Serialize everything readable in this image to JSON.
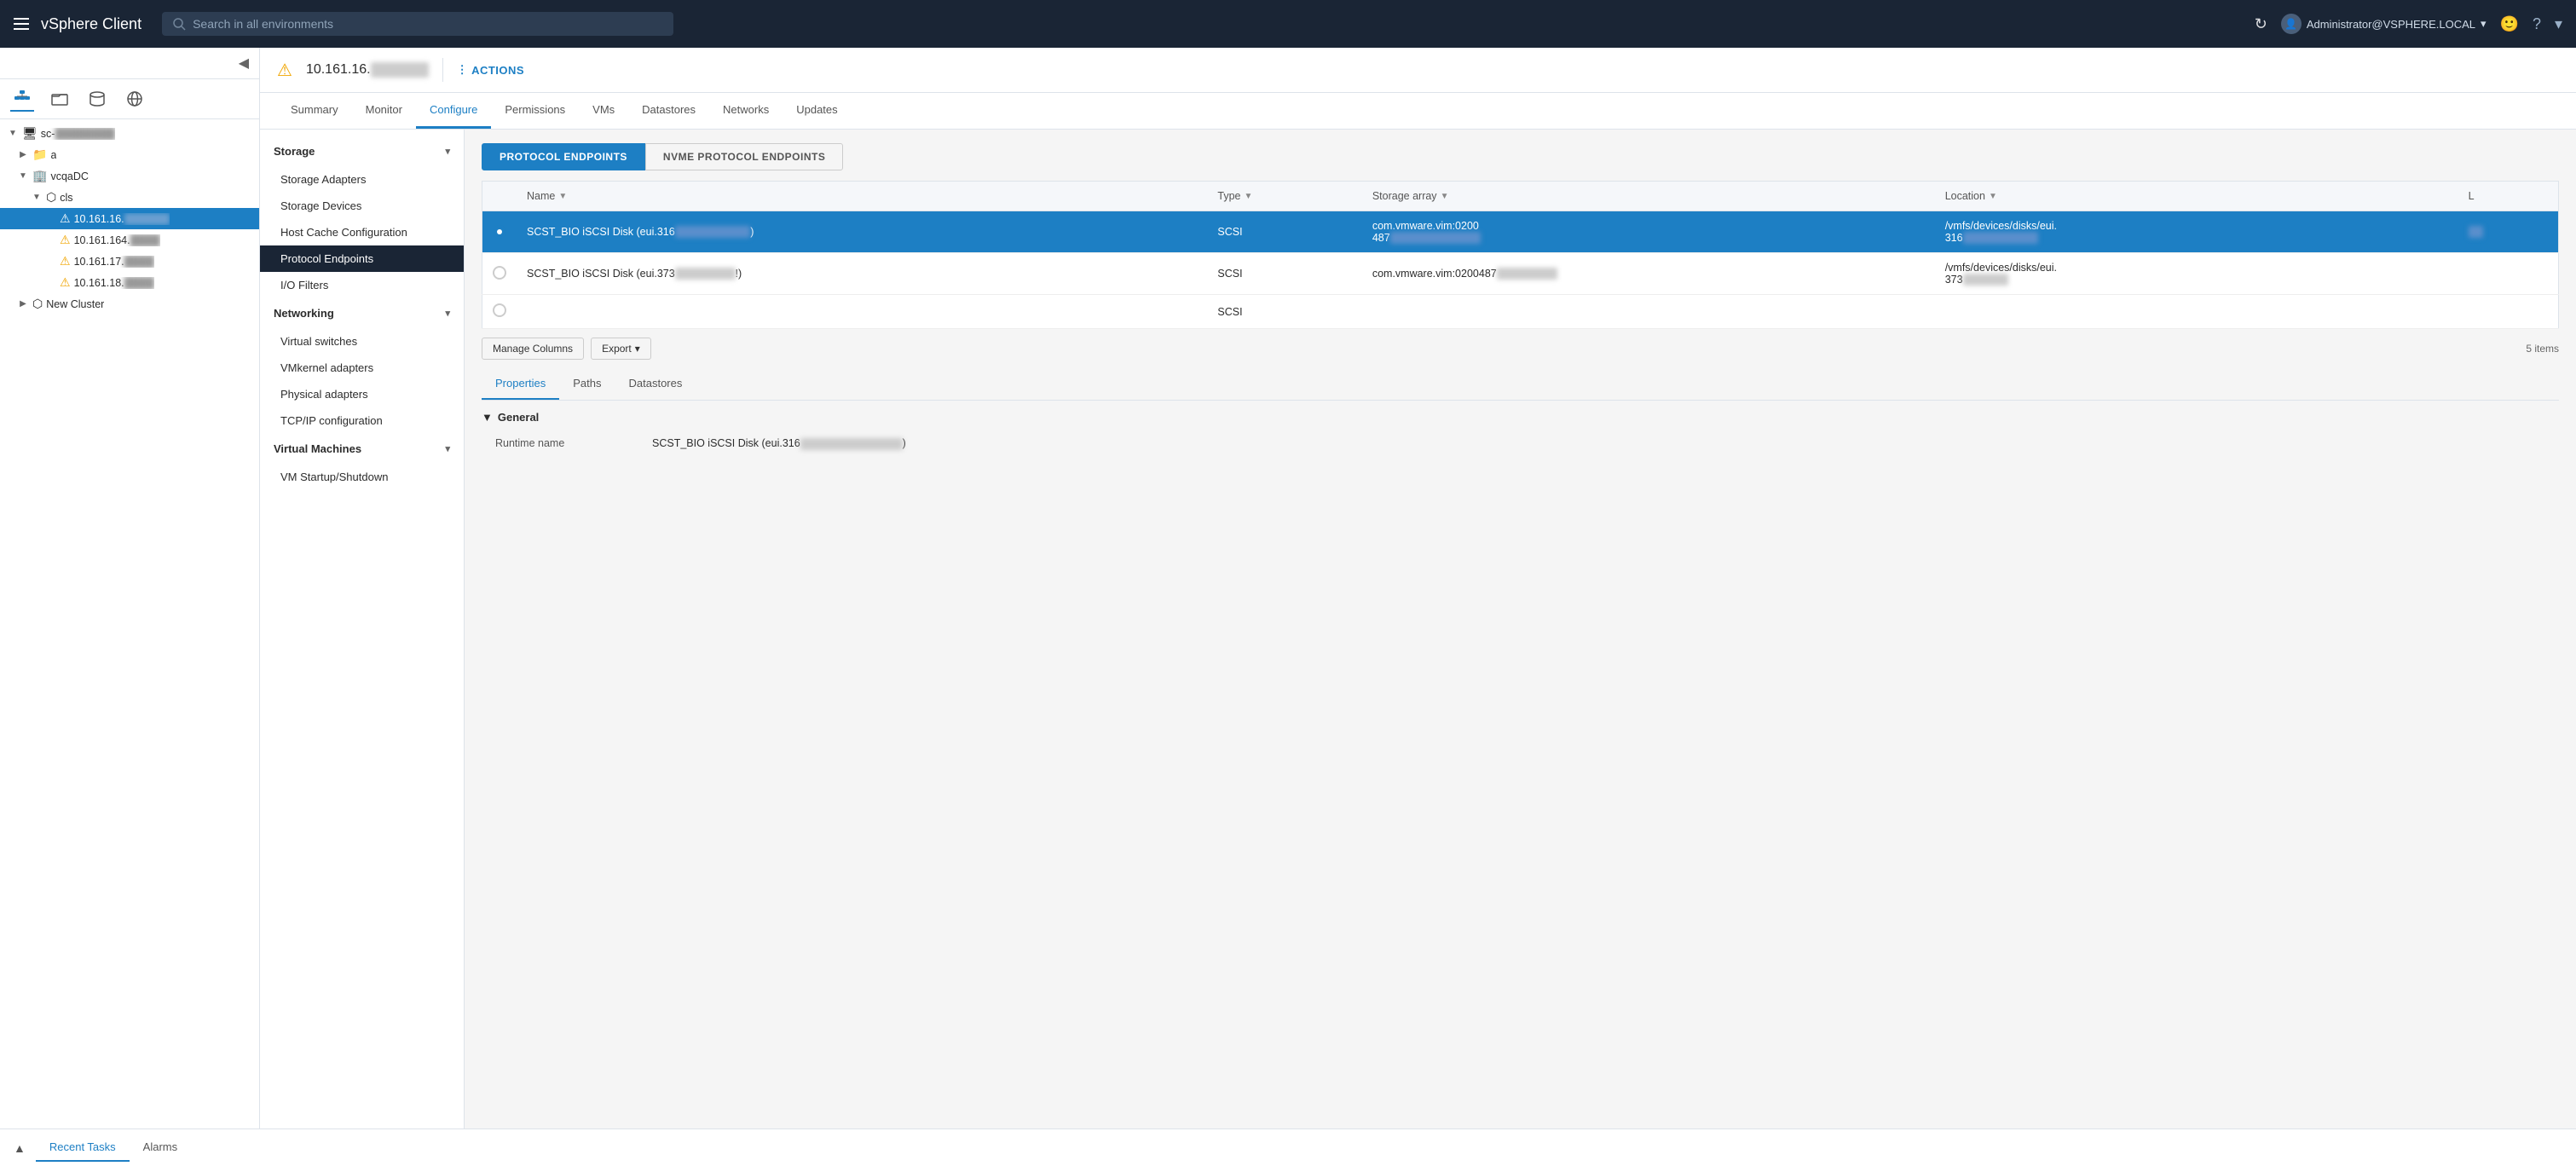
{
  "app": {
    "title": "vSphere Client"
  },
  "topnav": {
    "search_placeholder": "Search in all environments",
    "user": "Administrator@VSPHERE.LOCAL",
    "hamburger_label": "Menu"
  },
  "sidebar": {
    "icons": [
      {
        "name": "hierarchy-icon",
        "label": "Hierarchy",
        "active": true
      },
      {
        "name": "folders-icon",
        "label": "Folders"
      },
      {
        "name": "storage-icon",
        "label": "Storage"
      },
      {
        "name": "network-icon",
        "label": "Network"
      }
    ],
    "tree": [
      {
        "id": "sc",
        "label": "sc-",
        "blurred": true,
        "indent": 0,
        "type": "vcenter",
        "expanded": true
      },
      {
        "id": "a",
        "label": "a",
        "indent": 1,
        "type": "folder",
        "expanded": false
      },
      {
        "id": "vcqaDC",
        "label": "vcqaDC",
        "indent": 1,
        "type": "datacenter",
        "expanded": true
      },
      {
        "id": "cls",
        "label": "cls",
        "indent": 2,
        "type": "cluster",
        "expanded": true
      },
      {
        "id": "host1",
        "label": "10.161.16.",
        "blurred": true,
        "indent": 3,
        "type": "host",
        "selected": true,
        "warning": true
      },
      {
        "id": "host2",
        "label": "10.161.164.",
        "blurred": true,
        "indent": 3,
        "type": "host",
        "warning": true
      },
      {
        "id": "host3",
        "label": "10.161.17.",
        "blurred": true,
        "indent": 3,
        "type": "host",
        "warning": true
      },
      {
        "id": "host4",
        "label": "10.161.18.",
        "blurred": true,
        "indent": 3,
        "type": "host",
        "warning": true
      },
      {
        "id": "new-cluster",
        "label": "New Cluster",
        "indent": 1,
        "type": "cluster",
        "expanded": false
      }
    ]
  },
  "content": {
    "host_name": "10.161.16.",
    "actions_label": "ACTIONS",
    "tabs": [
      {
        "label": "Summary"
      },
      {
        "label": "Monitor"
      },
      {
        "label": "Configure",
        "active": true
      },
      {
        "label": "Permissions"
      },
      {
        "label": "VMs"
      },
      {
        "label": "Datastores"
      },
      {
        "label": "Networks"
      },
      {
        "label": "Updates"
      }
    ]
  },
  "config_menu": {
    "sections": [
      {
        "label": "Storage",
        "expanded": true,
        "items": [
          {
            "label": "Storage Adapters"
          },
          {
            "label": "Storage Devices"
          },
          {
            "label": "Host Cache Configuration"
          },
          {
            "label": "Protocol Endpoints",
            "active": true
          },
          {
            "label": "I/O Filters"
          }
        ]
      },
      {
        "label": "Networking",
        "expanded": true,
        "items": [
          {
            "label": "Virtual switches"
          },
          {
            "label": "VMkernel adapters"
          },
          {
            "label": "Physical adapters"
          },
          {
            "label": "TCP/IP configuration"
          }
        ]
      },
      {
        "label": "Virtual Machines",
        "expanded": true,
        "items": [
          {
            "label": "VM Startup/Shutdown"
          }
        ]
      }
    ]
  },
  "protocol_endpoints": {
    "tabs": [
      {
        "label": "PROTOCOL ENDPOINTS",
        "active": true
      },
      {
        "label": "NVME PROTOCOL ENDPOINTS"
      }
    ],
    "table": {
      "columns": [
        {
          "label": "Name"
        },
        {
          "label": "Type"
        },
        {
          "label": "Storage array"
        },
        {
          "label": "Location"
        },
        {
          "label": "L"
        }
      ],
      "rows": [
        {
          "selected": true,
          "name": "SCST_BIO iSCSI Disk (eui.316",
          "name_suffix": ")",
          "type": "SCSI",
          "storage_array": "com.vmware.vim:0200487",
          "location": "/vmfs/devices/disks/eui.316"
        },
        {
          "selected": false,
          "name": "SCST_BIO iSCSI Disk (eui.373",
          "name_suffix": "!)",
          "type": "SCSI",
          "storage_array": "com.vmware.vim:0200487",
          "location": "/vmfs/devices/disks/eui.373"
        },
        {
          "selected": false,
          "name": "",
          "type": "SCSI",
          "storage_array": "",
          "location": ""
        }
      ],
      "items_count": "5 items"
    },
    "toolbar": {
      "manage_columns": "Manage Columns",
      "export": "Export"
    }
  },
  "detail_panel": {
    "tabs": [
      {
        "label": "Properties",
        "active": true
      },
      {
        "label": "Paths"
      },
      {
        "label": "Datastores"
      }
    ],
    "general": {
      "title": "General",
      "properties": [
        {
          "label": "Runtime name",
          "value": "SCST_BIO iSCSI Disk (eui.316",
          "blurred": true
        }
      ]
    }
  },
  "bottom_bar": {
    "recent_tasks_label": "Recent Tasks",
    "alarms_label": "Alarms"
  }
}
